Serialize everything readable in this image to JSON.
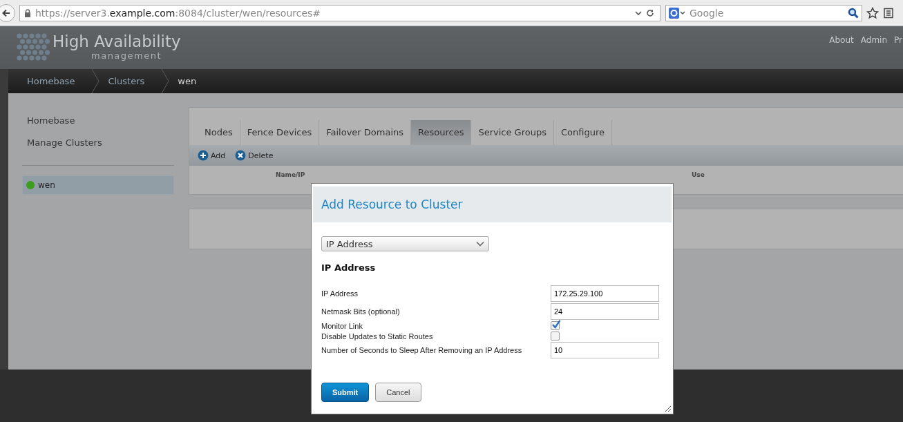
{
  "browser": {
    "url": "https://server3.**example.com**:8084/cluster/wen/resources#",
    "search": {
      "placeholder": "Google"
    }
  },
  "header": {
    "brand_title": "High Availability",
    "brand_subtitle": "management",
    "links": [
      "About",
      "Admin",
      "Pr"
    ]
  },
  "breadcrumb": [
    "Homebase",
    "Clusters",
    "wen"
  ],
  "sidebar": {
    "items": [
      "Homebase",
      "Manage Clusters"
    ],
    "clusters": [
      {
        "name": "wen",
        "selected": true,
        "color": "#3c9e1c"
      }
    ]
  },
  "tabs": [
    {
      "label": "Nodes",
      "selected": false
    },
    {
      "label": "Fence Devices",
      "selected": false
    },
    {
      "label": "Failover Domains",
      "selected": false
    },
    {
      "label": "Resources",
      "selected": true
    },
    {
      "label": "Service Groups",
      "selected": false
    },
    {
      "label": "Configure",
      "selected": false
    }
  ],
  "toolbar": [
    {
      "label": "Add",
      "kind": "add"
    },
    {
      "label": "Delete",
      "kind": "delete"
    }
  ],
  "table": {
    "columns": [
      "Name/IP",
      "Use"
    ]
  },
  "dialog": {
    "title": "Add Resource to Cluster",
    "resource_type": "IP Address",
    "section": "IP Address",
    "fields": [
      {
        "label": "IP Address",
        "kind": "text",
        "value": "172.25.29.100"
      },
      {
        "label": "Netmask Bits (optional)",
        "kind": "text",
        "value": "24"
      },
      {
        "label": "Monitor Link",
        "kind": "checkbox",
        "checked": true
      },
      {
        "label": "Disable Updates to Static Routes",
        "kind": "checkbox",
        "checked": false
      },
      {
        "label": "Number of Seconds to Sleep After Removing an IP Address",
        "kind": "text",
        "value": "10"
      }
    ],
    "buttons": [
      {
        "label": "Submit",
        "kind": "primary"
      },
      {
        "label": "Cancel",
        "kind": "secondary"
      }
    ]
  }
}
